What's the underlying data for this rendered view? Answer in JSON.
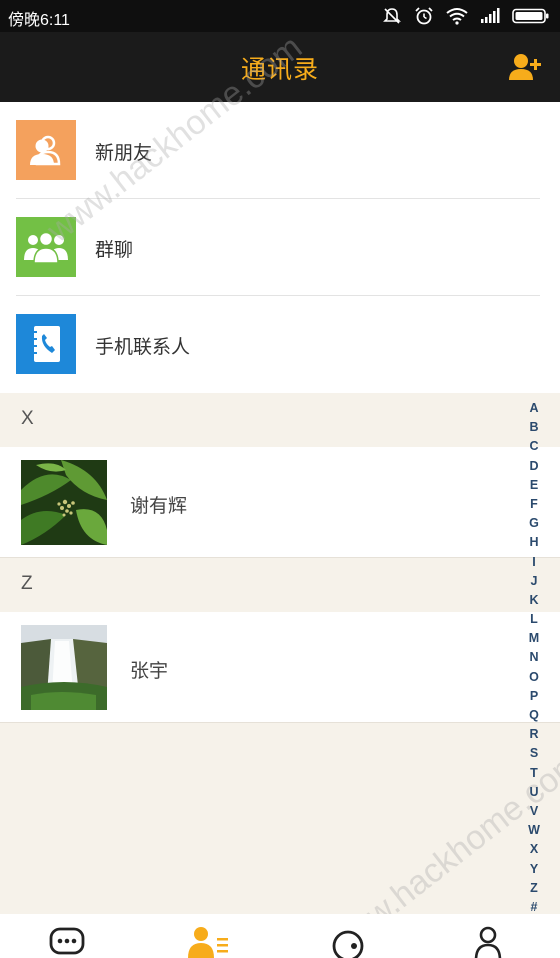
{
  "status_bar": {
    "time": "傍晚6:11",
    "icons": [
      "mute-icon",
      "alarm-icon",
      "wifi-icon",
      "signal-icon",
      "battery-icon"
    ]
  },
  "header": {
    "title": "通讯录",
    "title_color": "#f7ac1b",
    "action_icon": "add-friend-icon"
  },
  "menu": [
    {
      "label": "新朋友",
      "icon": "new-friends-icon",
      "color": "#f4a15d"
    },
    {
      "label": "群聊",
      "icon": "group-chat-icon",
      "color": "#73c045"
    },
    {
      "label": "手机联系人",
      "icon": "phone-contacts-icon",
      "color": "#1e88d9"
    }
  ],
  "sections": [
    {
      "letter": "X",
      "contacts": [
        {
          "name": "谢有辉",
          "avatar": "leaves-photo"
        }
      ]
    },
    {
      "letter": "Z",
      "contacts": [
        {
          "name": "张宇",
          "avatar": "waterfall-photo"
        }
      ]
    }
  ],
  "index_letters": [
    "A",
    "B",
    "C",
    "D",
    "E",
    "F",
    "G",
    "H",
    "I",
    "J",
    "K",
    "L",
    "M",
    "N",
    "O",
    "P",
    "Q",
    "R",
    "S",
    "T",
    "U",
    "V",
    "W",
    "X",
    "Y",
    "Z",
    "#"
  ],
  "watermark": "www.hackhome.com",
  "tabs": [
    {
      "icon": "messages-icon",
      "active": false
    },
    {
      "icon": "contacts-icon",
      "active": true
    },
    {
      "icon": "discover-icon",
      "active": false
    },
    {
      "icon": "profile-icon",
      "active": false
    }
  ],
  "accent_color": "#f7ac1b"
}
